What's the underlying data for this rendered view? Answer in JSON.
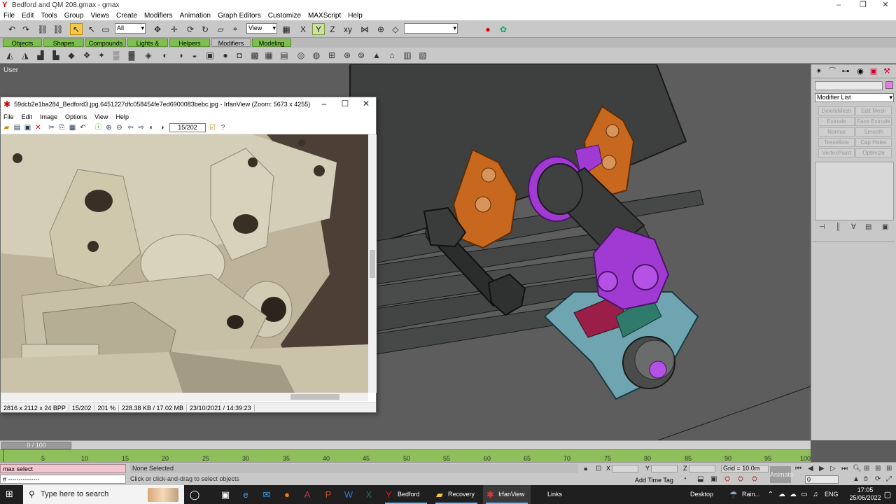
{
  "gmax": {
    "title": "Bedford and QM 208.gmax - gmax",
    "menu": [
      "File",
      "Edit",
      "Tools",
      "Group",
      "Views",
      "Create",
      "Modifiers",
      "Animation",
      "Graph Editors",
      "Customize",
      "MAXScript",
      "Help"
    ],
    "toolbar": {
      "selection_filter": "All",
      "ref_coord": "View",
      "named_sel": ""
    },
    "tabs": [
      "Objects",
      "Shapes",
      "Compounds",
      "Lights & Cameras",
      "Helpers",
      "Modifiers",
      "Modeling"
    ],
    "selected_tab": "Modifiers",
    "viewport_label": "User"
  },
  "irfan": {
    "title": "59dcb2e1ba284_Bedford3.jpg.6451227dfc058454fe7ed6900083bebc.jpg - IrfanView (Zoom: 5673 x 4255)",
    "menu": [
      "File",
      "Edit",
      "Image",
      "Options",
      "View",
      "Help"
    ],
    "page_counter": "15/202",
    "status": [
      "2816 x 2112 x 24 BPP",
      "15/202",
      "201 %",
      "228.38 KB / 17.02 MB",
      "23/10/2021 / 14:39:23"
    ]
  },
  "command_panel": {
    "modifier_list": "Modifier List",
    "buttons": [
      "DeleteMesh",
      "Edit Mesh",
      "Extrude",
      "Face Extrude",
      "Normal",
      "Smooth",
      "Tessellate",
      "Cap Holes",
      "VertexPaint",
      "Optimize"
    ]
  },
  "timeline": {
    "slider": "0 / 100",
    "ticks": [
      "5",
      "10",
      "15",
      "20",
      "25",
      "30",
      "35",
      "40",
      "45",
      "50",
      "55",
      "60",
      "65",
      "70",
      "75",
      "80",
      "85",
      "90",
      "95",
      "100"
    ]
  },
  "status": {
    "maxscript_line1": "max select",
    "maxscript_line2": "# ---------------",
    "selection": "None Selected",
    "prompt": "Click or click-and-drag to select objects",
    "x_label": "X",
    "y_label": "Y",
    "z_label": "Z",
    "grid": "Grid = 10.0m",
    "add_time_tag": "Add Time Tag",
    "animate": "Animate",
    "frame": "0"
  },
  "taskbar": {
    "search_placeholder": "Type here to search",
    "apps": [
      {
        "label": "Bedford a...",
        "icon": "gmax-icon"
      },
      {
        "label": "Recovery ...",
        "icon": "folder-icon"
      },
      {
        "label": "IrfanView ...",
        "icon": "irfanview-icon"
      },
      {
        "label": "Links",
        "icon": ""
      }
    ],
    "desktop": "Desktop",
    "weather": "Rain...",
    "lang": "ENG",
    "time": "17:05",
    "date": "25/06/2022"
  },
  "colors": {
    "orange_part": "#c8681e",
    "purple_part": "#a03ad2",
    "blue_part": "#6fa5b0",
    "dark_part": "#3a3c3c",
    "timeline_green": "#8fbf5a"
  }
}
